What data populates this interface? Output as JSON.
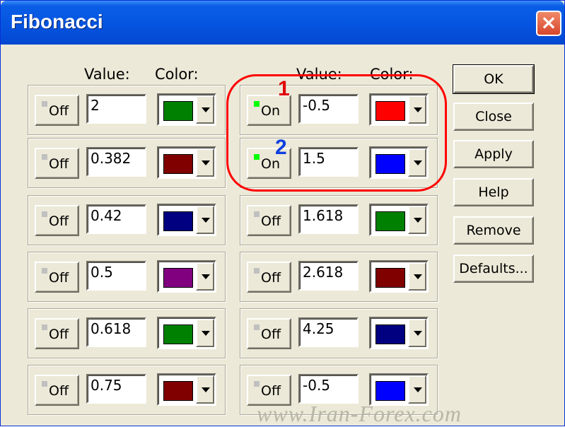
{
  "window": {
    "title": "Fibonacci",
    "close_glyph": "×"
  },
  "headers": {
    "value": "Value:",
    "color": "Color:"
  },
  "left_column": [
    {
      "state": "Off",
      "value": "2",
      "color": "#008000"
    },
    {
      "state": "Off",
      "value": "0.382",
      "color": "#800000"
    },
    {
      "state": "Off",
      "value": "0.42",
      "color": "#000080"
    },
    {
      "state": "Off",
      "value": "0.5",
      "color": "#800080"
    },
    {
      "state": "Off",
      "value": "0.618",
      "color": "#008000"
    },
    {
      "state": "Off",
      "value": "0.75",
      "color": "#800000"
    }
  ],
  "right_column": [
    {
      "state": "On",
      "value": "-0.5",
      "color": "#ff0000"
    },
    {
      "state": "On",
      "value": "1.5",
      "color": "#0000ff"
    },
    {
      "state": "Off",
      "value": "1.618",
      "color": "#008000"
    },
    {
      "state": "Off",
      "value": "2.618",
      "color": "#800000"
    },
    {
      "state": "Off",
      "value": "4.25",
      "color": "#000080"
    },
    {
      "state": "Off",
      "value": "-0.5",
      "color": "#0000ff"
    }
  ],
  "buttons": {
    "ok": "OK",
    "close": "Close",
    "apply": "Apply",
    "help": "Help",
    "remove": "Remove",
    "defaults": "Defaults..."
  },
  "annotations": {
    "mark1": "1",
    "mark2": "2",
    "highlight_color": "#ff0000",
    "mark1_color": "#e00000",
    "mark2_color": "#1040e0"
  },
  "watermark": "www.Iran-Forex.com"
}
